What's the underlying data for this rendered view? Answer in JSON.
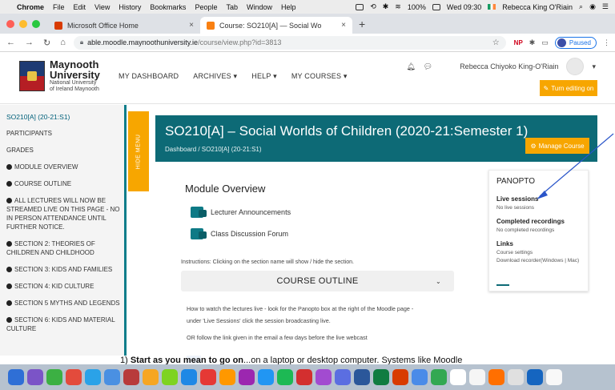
{
  "menubar": {
    "app": "Chrome",
    "menus": [
      "File",
      "Edit",
      "View",
      "History",
      "Bookmarks",
      "People",
      "Tab",
      "Window",
      "Help"
    ],
    "battery": "100%",
    "time": "Wed 09:30",
    "user": "Rebecca King O'Riain"
  },
  "tabs": [
    {
      "title": "Microsoft Office Home",
      "favicon_color": "#d83b01"
    },
    {
      "title": "Course: SO210[A] — Social Wo",
      "favicon_color": "#f98012"
    }
  ],
  "address": {
    "host": "able.moodle.maynoothuniversity.ie",
    "path": "/course/view.php?id=3813",
    "np_label": "NP",
    "profile_label": "Paused"
  },
  "header": {
    "logo_line1": "Maynooth",
    "logo_line2": "University",
    "logo_line3": "National University",
    "logo_line4": "of Ireland Maynooth",
    "nav": [
      "MY DASHBOARD",
      "ARCHIVES ▾",
      "HELP ▾",
      "MY COURSES ▾"
    ],
    "user_name": "Rebecca Chiyoko King-O'Riain",
    "edit_button": "Turn editing on"
  },
  "drawer": {
    "course": "SO210[A] (20-21:S1)",
    "plain_items": [
      "PARTICIPANTS",
      "GRADES"
    ],
    "items": [
      "MODULE OVERVIEW",
      "COURSE OUTLINE",
      "ALL LECTURES WILL NOW BE STREAMED LIVE ON THIS PAGE - NO IN PERSON ATTENDANCE UNTIL FURTHER NOTICE.",
      "SECTION 2: THEORIES OF CHILDREN AND CHILDHOOD",
      "SECTION 3: KIDS AND FAMILIES",
      "SECTION 4: KID CULTURE",
      "SECTION 5 MYTHS AND LEGENDS",
      "SECTION 6: KIDS AND MATERIAL CULTURE"
    ]
  },
  "hide_menu": "HIDE MENU",
  "banner": {
    "title": "SO210[A] – Social Worlds of Children (2020-21:Semester 1)",
    "breadcrumb": "Dashboard / SO210[A] (20-21:S1)",
    "manage_button": "Manage Course"
  },
  "panopto": {
    "title": "PANOPTO",
    "live_heading": "Live sessions",
    "live_value": "No live sessions",
    "completed_heading": "Completed recordings",
    "completed_value": "No completed recordings",
    "links_heading": "Links",
    "link1": "Course settings",
    "link2": "Download recorder(Windows | Mac)"
  },
  "main": {
    "module_title": "Module Overview",
    "forum1": "Lecturer Announcements",
    "forum2": "Class Discussion Forum",
    "instructions": "Instructions: Clicking on the section name will show / hide the section.",
    "outline_label": "COURSE OUTLINE",
    "line1": "How to watch the lectures live - look for the Panopto box at the right of the Moodle page -",
    "line2": "under 'Live Sessions' click the session broadcasting live.",
    "line3": "OR follow the link given in the email a few days before the live webcast"
  },
  "overlay": {
    "prefix": "1)  ",
    "bold": "Start as you mean to go on",
    "rest": "...on a laptop or desktop computer. Systems like Moodle"
  },
  "dock_colors": [
    "#2f6fd6",
    "#7b54c7",
    "#3cb043",
    "#e34b3c",
    "#2aa2e8",
    "#4a90e2",
    "#b83b3b",
    "#f6a623",
    "#7ed321",
    "#1e88e5",
    "#e53935",
    "#ff9800",
    "#9c27b0",
    "#2196f3",
    "#1db954",
    "#d32f2f",
    "#a24bd0",
    "#5b6ee1",
    "#2b579a",
    "#107c41",
    "#d83b01",
    "#4a8be8",
    "#33a852",
    "#ffffff",
    "#f5f5f5",
    "#ff6f00",
    "#e0e0e0",
    "#1565c0",
    "#f8f8f8"
  ]
}
